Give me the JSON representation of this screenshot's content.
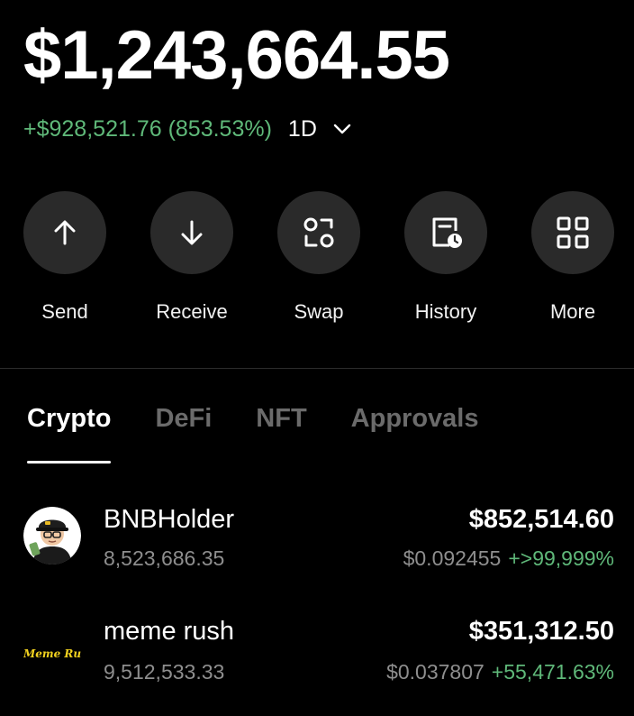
{
  "portfolio": {
    "balance": "$1,243,664.55",
    "change": "+$928,521.76 (853.53%)",
    "period": "1D"
  },
  "actions": [
    {
      "label": "Send",
      "icon": "arrow-up-icon"
    },
    {
      "label": "Receive",
      "icon": "arrow-down-icon"
    },
    {
      "label": "Swap",
      "icon": "swap-icon"
    },
    {
      "label": "History",
      "icon": "history-icon"
    },
    {
      "label": "More",
      "icon": "grid-icon"
    }
  ],
  "tabs": [
    {
      "label": "Crypto",
      "active": true
    },
    {
      "label": "DeFi",
      "active": false
    },
    {
      "label": "NFT",
      "active": false
    },
    {
      "label": "Approvals",
      "active": false
    }
  ],
  "tokens": [
    {
      "name": "BNBHolder",
      "amount": "8,523,686.35",
      "value": "$852,514.60",
      "price": "$0.092455",
      "change": "+>99,999%",
      "icon": "bnbholder-avatar-icon"
    },
    {
      "name": "meme rush",
      "amount": "9,512,533.33",
      "value": "$351,312.50",
      "price": "$0.037807",
      "change": "+55,471.63%",
      "icon": "meme-rush-logo-icon",
      "logo_text": "Meme Rush"
    }
  ],
  "colors": {
    "background": "#000000",
    "positive": "#5fb879",
    "button_bg": "#2a2a2a",
    "muted_text": "#8e8e8e"
  }
}
